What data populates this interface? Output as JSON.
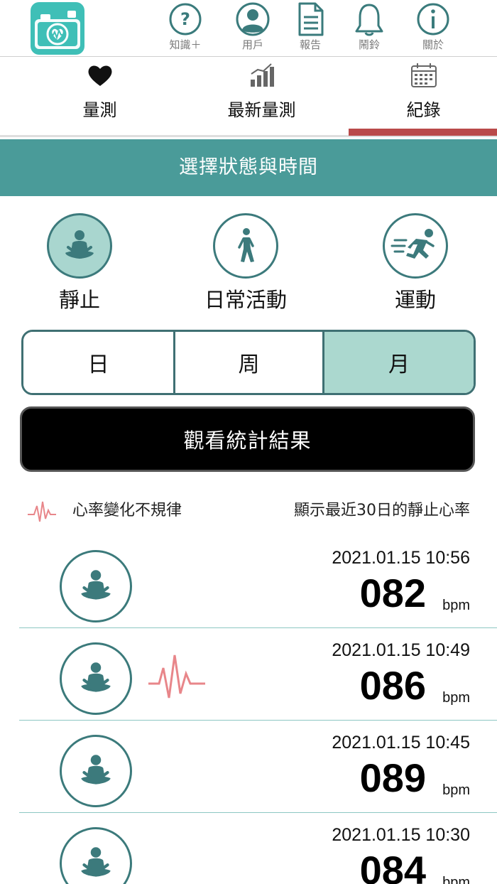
{
  "header": {
    "buttons": [
      {
        "label": "知識＋",
        "icon": "question-circle-icon"
      },
      {
        "label": "用戶",
        "icon": "user-circle-icon"
      },
      {
        "label": "報告",
        "icon": "document-icon"
      },
      {
        "label": "鬧鈴",
        "icon": "bell-icon"
      },
      {
        "label": "關於",
        "icon": "info-circle-icon"
      }
    ],
    "logo_icon": "heart-camera-logo-icon"
  },
  "tabs": [
    {
      "label": "量測",
      "icon": "heart-icon",
      "active": false
    },
    {
      "label": "最新量測",
      "icon": "bar-chart-icon",
      "active": false
    },
    {
      "label": "紀錄",
      "icon": "calendar-icon",
      "active": true
    }
  ],
  "section_title": "選擇狀態與時間",
  "status_options": [
    {
      "label": "靜止",
      "icon": "meditation-icon",
      "selected": true
    },
    {
      "label": "日常活動",
      "icon": "walking-icon",
      "selected": false
    },
    {
      "label": "運動",
      "icon": "running-icon",
      "selected": false
    }
  ],
  "periods": [
    {
      "label": "日",
      "selected": false
    },
    {
      "label": "周",
      "selected": false
    },
    {
      "label": "月",
      "selected": true
    }
  ],
  "stats_button": "觀看統計結果",
  "legend": {
    "irregular_label": "心率變化不規律",
    "note": "顯示最近30日的靜止心率"
  },
  "records": [
    {
      "time": "2021.01.15 10:56",
      "value": "082",
      "unit": "bpm",
      "irregular": false
    },
    {
      "time": "2021.01.15 10:49",
      "value": "086",
      "unit": "bpm",
      "irregular": true
    },
    {
      "time": "2021.01.15 10:45",
      "value": "089",
      "unit": "bpm",
      "irregular": false
    },
    {
      "time": "2021.01.15 10:30",
      "value": "084",
      "unit": "bpm",
      "irregular": false
    }
  ],
  "colors": {
    "teal": "#4a9b99",
    "teal_dark": "#3c7a7c",
    "selected_fill": "#abd8cf",
    "tab_indicator": "#b94a4a",
    "irregular_wave": "#e8868a",
    "logo": "#3fbfb7"
  }
}
